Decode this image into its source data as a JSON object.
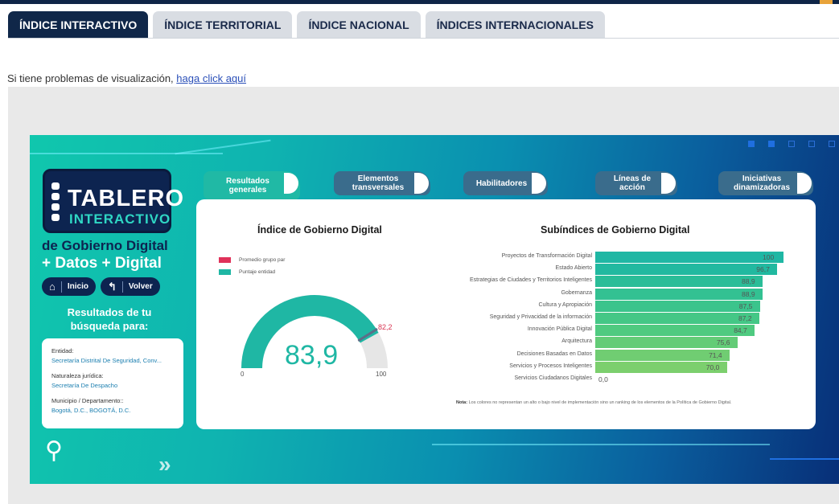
{
  "tabs": [
    {
      "label": "ÍNDICE INTERACTIVO"
    },
    {
      "label": "ÍNDICE TERRITORIAL"
    },
    {
      "label": "ÍNDICE NACIONAL"
    },
    {
      "label": "ÍNDICES INTERNACIONALES"
    }
  ],
  "notice": {
    "text": "Si tiene problemas de visualización, ",
    "link": "haga click aquí"
  },
  "dashboard": {
    "logo_line1": "TABLERO",
    "logo_line2": "INTERACTIVO",
    "subtitle1": "de Gobierno Digital",
    "subtitle2": "+ Datos + Digital",
    "nav": {
      "home": "Inicio",
      "back": "Volver"
    },
    "results_title": "Resultados de tu búsqueda para:",
    "entity": {
      "entity_label": "Entidad:",
      "entity_value": "Secretaría Distrital De Seguridad, Conv...",
      "nature_label": "Naturaleza jurídica:",
      "nature_value": "Secretaría De Despacho",
      "location_label": "Municipio / Departamento::",
      "location_value": "Bogotá, D.C., BOGOTÁ, D.C."
    },
    "tabs": [
      {
        "label": "Resultados generales"
      },
      {
        "label": "Elementos transversales"
      },
      {
        "label": "Habilitadores"
      },
      {
        "label": "Líneas de acción"
      },
      {
        "label": "Iniciativas dinamizadoras"
      }
    ],
    "gauge_title": "Índice de Gobierno Digital",
    "legend": [
      {
        "label": "Promedio grupo par",
        "color": "#e0325a"
      },
      {
        "label": "Puntaje entidad",
        "color": "#1fb7a4"
      }
    ],
    "gauge": {
      "value": "83,9",
      "reference": "82,2",
      "min": "0",
      "max": "100",
      "value_num": 83.9,
      "reference_num": 82.2
    },
    "bars_title": "Subíndices de Gobierno Digital",
    "note_bold": "Nota:",
    "note": " Los colores no representan un alto o bajo nivel de implementación sino un ranking de los elementos de la Política de Gobierno Digital."
  },
  "chart_data": {
    "type": "bar",
    "title": "Subíndices de Gobierno Digital",
    "categories": [
      "Proyectos de Transformación Digital",
      "Estado Abierto",
      "Estrategias de Ciudades y Territorios Inteligentes",
      "Gobernanza",
      "Cultura y Apropiación",
      "Seguridad y Privacidad de la información",
      "Innovación Pública Digital",
      "Arquitectura",
      "Decisiones Basadas en Datos",
      "Servicios y Procesos Inteligentes",
      "Servicios Ciudadanos Digitales"
    ],
    "values": [
      100,
      96.7,
      88.9,
      88.9,
      87.5,
      87.2,
      84.7,
      75.6,
      71.4,
      70.0,
      0.0
    ],
    "labels": [
      "100",
      "96,7",
      "88,9",
      "88,9",
      "87,5",
      "87,2",
      "84,7",
      "75,6",
      "71,4",
      "70,0",
      "0,0"
    ],
    "colors": [
      "#1fb7a4",
      "#21b9a0",
      "#2abd98",
      "#33c192",
      "#3bc48c",
      "#44c786",
      "#4fca80",
      "#63cc77",
      "#70cd72",
      "#7ccf6e",
      "#9bd36a"
    ],
    "xlim": [
      0,
      100
    ]
  }
}
